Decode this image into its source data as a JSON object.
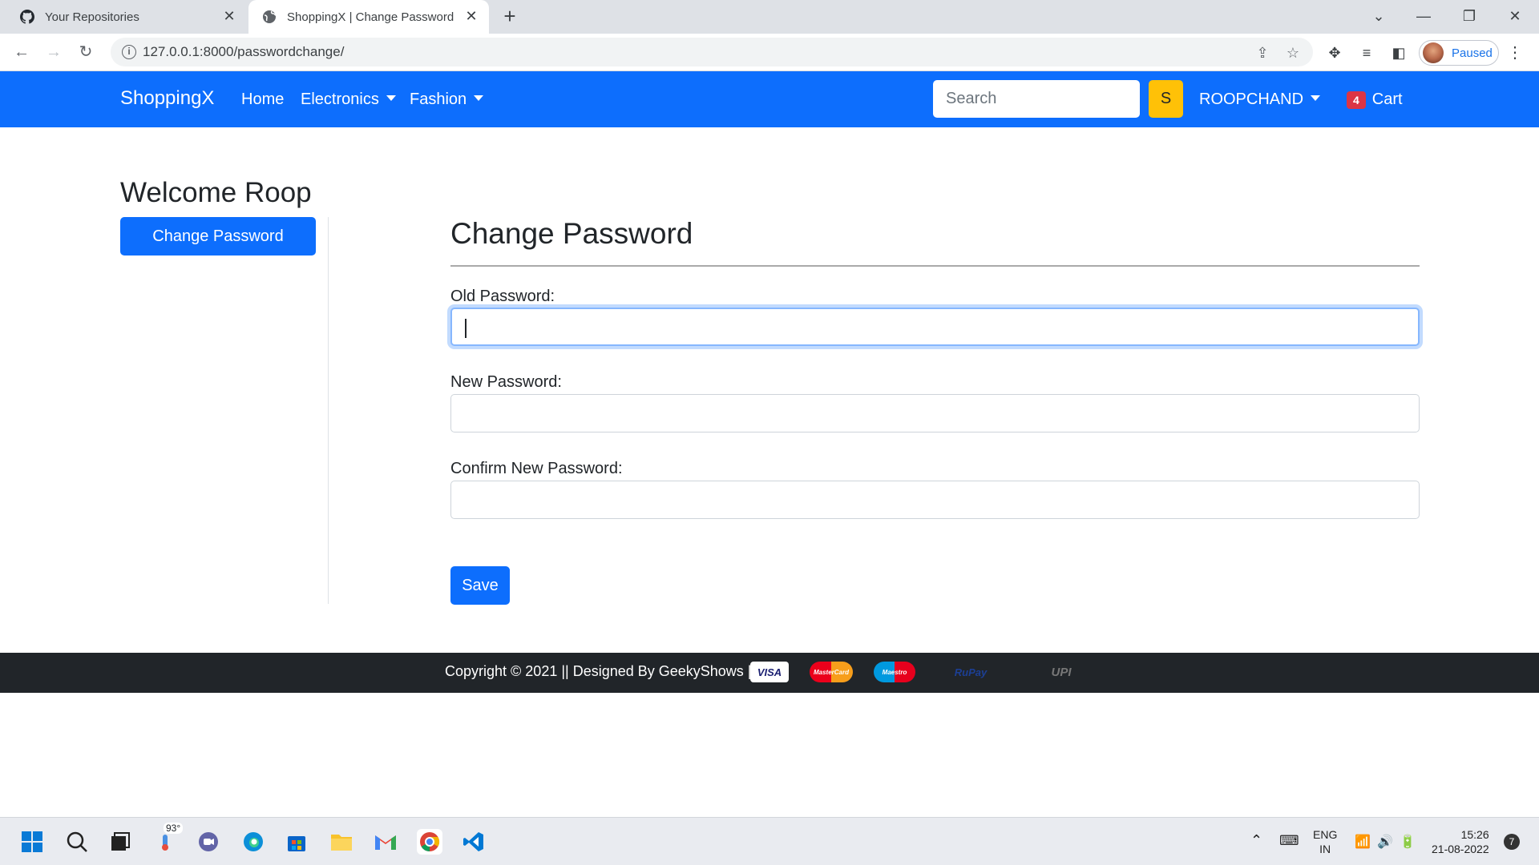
{
  "browser": {
    "tabs": [
      {
        "title": "Your Repositories",
        "active": false
      },
      {
        "title": "ShoppingX | Change Password",
        "active": true
      }
    ],
    "url": "127.0.0.1:8000/passwordchange/",
    "profile_label": "Paused"
  },
  "site": {
    "brand": "ShoppingX",
    "nav": {
      "home": "Home",
      "electronics": "Electronics",
      "fashion": "Fashion"
    },
    "search": {
      "placeholder": "Search",
      "button_label": "S"
    },
    "user_menu": "ROOPCHAND",
    "cart": {
      "count": "4",
      "label": "Cart"
    }
  },
  "sidebar": {
    "welcome": "Welcome Roop",
    "change_password_button": "Change Password"
  },
  "form": {
    "title": "Change Password",
    "fields": [
      {
        "label": "Old Password:",
        "value": "",
        "focused": true
      },
      {
        "label": "New Password:",
        "value": "",
        "focused": false
      },
      {
        "label": "Confirm New Password:",
        "value": "",
        "focused": false
      }
    ],
    "save_label": "Save"
  },
  "footer": {
    "text": "Copyright © 2021 || Designed By GeekyShows ||",
    "payment_logos": [
      "VISA",
      "MasterCard",
      "Maestro",
      "RuPay",
      "UPI"
    ]
  },
  "taskbar": {
    "weather": "93°",
    "lang_line1": "ENG",
    "lang_line2": "IN",
    "time": "15:26",
    "date": "21-08-2022",
    "notification_count": "7"
  },
  "colors": {
    "primary": "#0d6efd",
    "warning": "#ffc107",
    "danger": "#dc3545",
    "dark": "#212529"
  }
}
